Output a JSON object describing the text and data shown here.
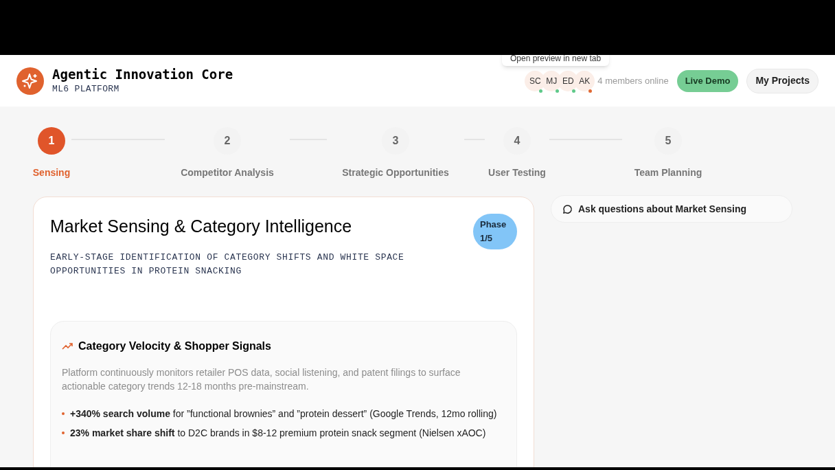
{
  "header": {
    "title": "Agentic Innovation Core",
    "subtitle": "ML6 PLATFORM",
    "tooltip": "Open preview in new tab",
    "members": [
      {
        "initials": "SC",
        "color": "#5fc98a"
      },
      {
        "initials": "MJ",
        "color": "#5fc98a"
      },
      {
        "initials": "ED",
        "color": "#5fc98a"
      },
      {
        "initials": "AK",
        "color": "#e06a35"
      }
    ],
    "members_online": "4 members online",
    "buttons": [
      {
        "label": "Live Demo",
        "kind": "primary"
      },
      {
        "label": "My Projects",
        "kind": "secondary"
      }
    ]
  },
  "steps": [
    {
      "number": "1",
      "label": "Sensing",
      "selected": true
    },
    {
      "number": "2",
      "label": "Competitor Analysis",
      "selected": false
    },
    {
      "number": "3",
      "label": "Strategic Opportunities",
      "selected": false
    },
    {
      "number": "4",
      "label": "User Testing",
      "selected": false
    },
    {
      "number": "5",
      "label": "Team Planning",
      "selected": false
    }
  ],
  "phase_card": {
    "title": "Market Sensing & Category Intelligence",
    "subtitle": "EARLY-STAGE IDENTIFICATION OF CATEGORY SHIFTS AND WHITE SPACE OPPORTUNITIES IN PROTEIN SNACKING",
    "badge": "Phase 1/5",
    "section": {
      "title": "Category Velocity & Shopper Signals",
      "description": "Platform continuously monitors retailer POS data, social listening, and patent filings to surface actionable category trends 12-18 months pre-mainstream.",
      "bullets": [
        "**+340% search volume** for ”functional brownies” and ”protein dessert” (Google Trends, 12mo rolling)",
        "**23% market share shift** to D2C brands in $8-12 premium protein snack segment (Nielsen xAOC)"
      ]
    }
  },
  "chat_button": "Ask questions about Market Sensing"
}
